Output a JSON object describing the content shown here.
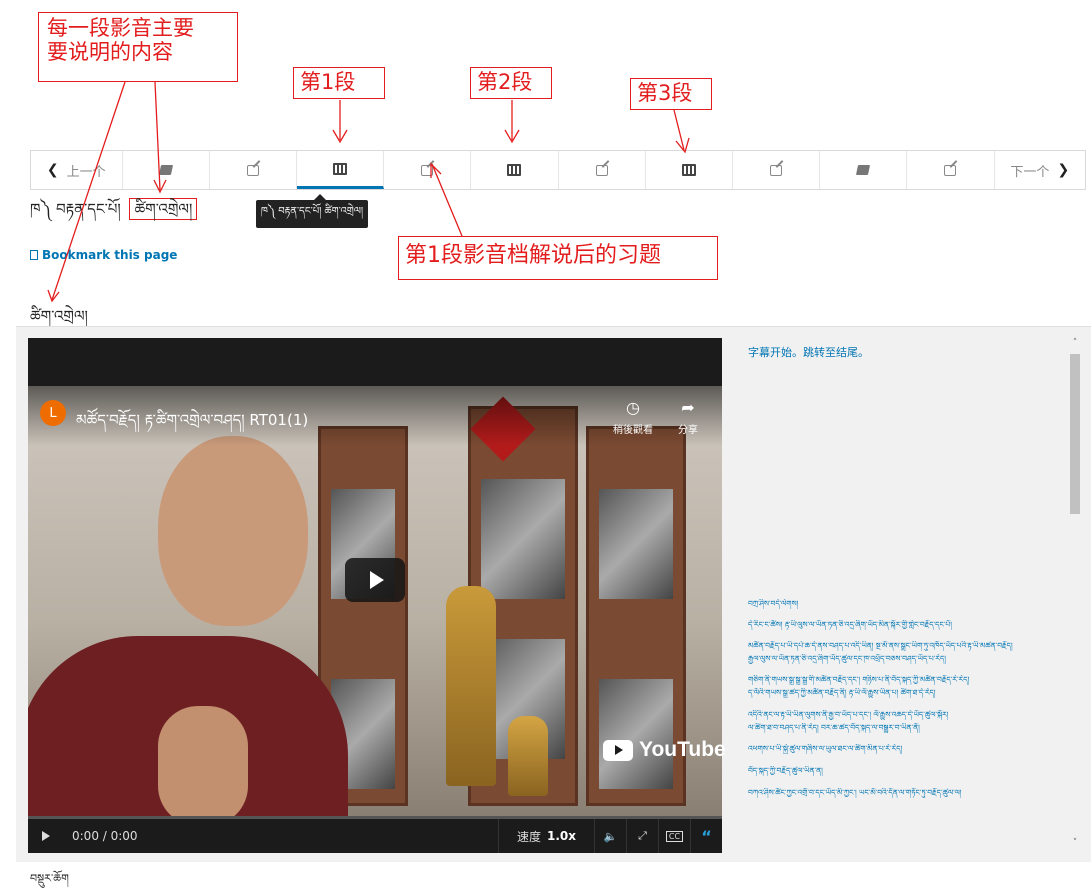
{
  "annotations": {
    "top_left": [
      "每一段影音主要",
      "要说明的内容"
    ],
    "seg1": "第1段",
    "seg2": "第2段",
    "seg3": "第3段",
    "exercise": "第1段影音档解说后的习题"
  },
  "nav": {
    "prev_label": "上一个",
    "next_label": "下一个",
    "items": [
      {
        "icon": "book-icon"
      },
      {
        "icon": "edit-icon"
      },
      {
        "icon": "film-icon",
        "active": true
      },
      {
        "icon": "edit-icon"
      },
      {
        "icon": "film-icon"
      },
      {
        "icon": "edit-icon"
      },
      {
        "icon": "film-icon"
      },
      {
        "icon": "edit-icon"
      },
      {
        "icon": "book-icon"
      },
      {
        "icon": "edit-icon"
      }
    ],
    "tooltip": "ཁ༽ བརྟན་དང་པོ། ཚིག་འགྲེལ།"
  },
  "unit": {
    "prefix": "ཁ༽ བརྟན་དང་པོ།",
    "title": "ཚིག་འགྲེལ།",
    "bookmark": "Bookmark this page",
    "section_heading": "ཚིག་འགྲེལ།"
  },
  "video": {
    "channel_initial": "L",
    "title": "མཚོད་བརྗོད། རྟ་ཚིག་འགྲེལ་བཤད། RT01(1)",
    "watch_later": "稍後觀看",
    "share": "分享",
    "youtube": "YouTube",
    "time": "0:00 / 0:00",
    "speed_label": "速度",
    "speed_value": "1.0x",
    "cc": "CC"
  },
  "transcript": {
    "head": "字幕开始。跳转至结尾。",
    "lines": [
      "བཀྲ་ཤིས་བདེ་ལེགས།",
      "དེ་རིང་ང་ཚོས། རྟ་ཡི་ལུས་ལ་ཡོན་ཏན་ཅི་འདྲ་ཞིག་ཡོད་མིན་སྐོར་གྱི་གླེང་བརྗོད་དང་པོ།",
      "མཚོན་བརྗོད་པ་ཡི་དཔེ་ཆ་དེ་ནས་བཤད་པ་འདི་ཡིན། སྔ་མོ་ནས་སྒྲུང་ཡིག་ཏུ་འཁོད་ཡོད་པའི་རྟ་ཡི་མཚན་བརྗོད།",
      "རྒྱལ་ལུས་ལ་ཡོན་ཏན་ཅི་འདྲ་ཞིག་ཡོད་ཚུལ་དང་ཁ་འཕྲོད་བཅས་བཤད་ཡོད་པ་རེད།",
      "གཅིག་ནི་གཡས་སྒྲ་སྒྲ་སྒྲ་གི་མཚོན་བརྗོད་དང་། གཉིས་པ་ནི་བོད་སྐད་ཀྱི་མཚོན་བརྗོད་རེ་རེད།",
      "ད་ལོའི་གཡས་སྒྲ་ཚད་ཀྱི་མཚོན་བརྗོད་ནི། རྟ་ཡི་ལོ་རྒྱུས་ཡིན་པ། ཚིག་ཐ་དེ་རེད།",
      "འདིའི་ནང་ལ་རྟ་ཡི་ཡིན་ལུགས་ནི་རྒྱ་བ་ཡོད་པ་དང་། ལོ་རྒྱུས་འཆད་དེ་ཡོད་ཚུལ་སྐོར།",
      "ལ་ཚིག་ཐ་བ་བཤད་པ་ནི་རེད། བར་ཆ་ཚད་བོད་སྐད་ལ་བསྒྱུར་བ་ཡིན་ནོ།",
      "འཕགས་པ་ཡི་སྐྱེ་ཚུལ་གཞིས་ལ་ཡུལ་ཐང་ལ་ཚིག་མིན་པ་རེ་རེད།",
      "བོད་སྐད་ཀྱི་བརྗོད་ཚུལ་ཡིན་ན།",
      "བཀའ་ཤིས་ཚོང་ཀྱང་འགྲོ་བ་དང་ཡོད་མི་ཀྱང་། ཡང་མོ་བའི་དོན་ལ་གཏོང་ཏུ་བརྗོད་ཚུལ་ལ།"
    ]
  },
  "footer_label": "བསྡུར་ཆོག"
}
